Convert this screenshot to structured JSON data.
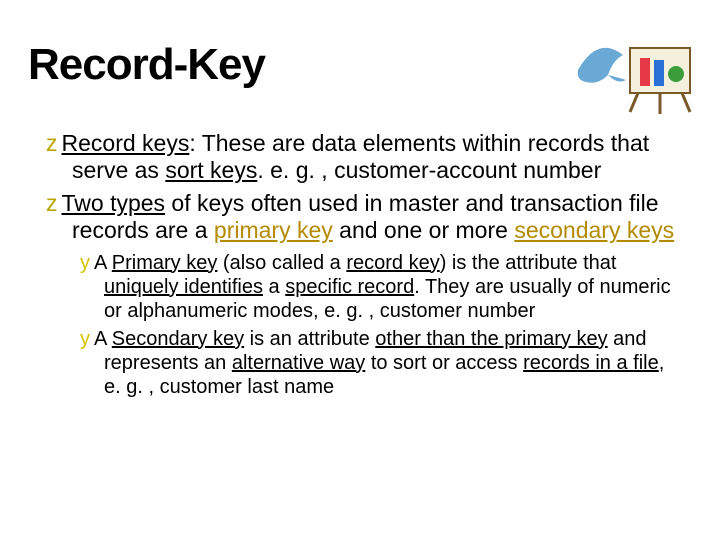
{
  "title": "Record-Key",
  "bullets": {
    "z1": {
      "lead": "Record keys",
      "rest1": ": These are data elements within records that serve as ",
      "sort": "sort keys",
      "rest2": ". e. g. , customer-account number"
    },
    "z2": {
      "lead": "Two types",
      "rest1": " of keys often used in master and transaction file records are a ",
      "pk": "primary key",
      "rest2": " and one or more ",
      "sk": "secondary keys"
    },
    "y1": {
      "pre": "A ",
      "pk": "Primary key",
      "mid1": " (also called a ",
      "rk": "record key",
      "mid2": ") is the attribute that ",
      "uniq": "uniquely identifies",
      "mid3": " a ",
      "spec": "specific record",
      "tail": ". They are usually of numeric or alphanumeric modes, e. g. , customer number"
    },
    "y2": {
      "pre": "A ",
      "sk": "Secondary key",
      "mid1": " is an attribute ",
      "other": "other than the primary key",
      "mid2": " and represents an ",
      "alt": "alternative way",
      "mid3": " to sort or access ",
      "rif": "records in a file",
      "tail": ", e. g. , customer last name"
    }
  }
}
